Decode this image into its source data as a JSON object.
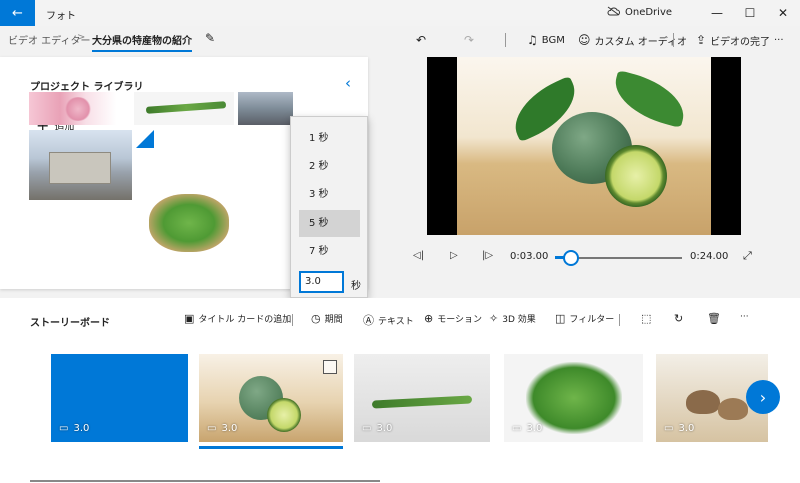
{
  "window": {
    "app_title": "フォト",
    "onedrive_label": "OneDrive",
    "minimize": "—",
    "maximize": "☐",
    "close": "✕",
    "back": "←"
  },
  "toolbar": {
    "breadcrumb_root": "ビデオ エディター",
    "breadcrumb_sep": ">",
    "project_name": "大分県の特産物の紹介",
    "undo": "↶",
    "redo": "↷",
    "bgm_label": "BGM",
    "custom_audio_label": "カスタム オーディオ",
    "finish_video_label": "ビデオの完了",
    "more": "···"
  },
  "library": {
    "title": "プロジェクト ライブラリ",
    "add_label": "追加",
    "collapse": "‹"
  },
  "duration_menu": {
    "options": [
      "1 秒",
      "2 秒",
      "3 秒",
      "5 秒",
      "7 秒"
    ],
    "selected_index": 3,
    "input_value": "3.0",
    "unit": "秒"
  },
  "playback": {
    "current_time": "0:03.00",
    "end_time": "0:24.00",
    "progress": 0.125
  },
  "storyboard": {
    "title": "ストーリーボード",
    "tools": {
      "title_card": "タイトル カードの追加",
      "duration": "期間",
      "text": "テキスト",
      "motion": "モーション",
      "effects_3d": "3D 効果",
      "filter": "フィルター"
    },
    "clips": [
      {
        "duration": "3.0"
      },
      {
        "duration": "3.0"
      },
      {
        "duration": "3.0"
      },
      {
        "duration": "3.0"
      },
      {
        "duration": "3.0"
      }
    ],
    "next": "›"
  },
  "colors": {
    "accent": "#0078d7"
  }
}
